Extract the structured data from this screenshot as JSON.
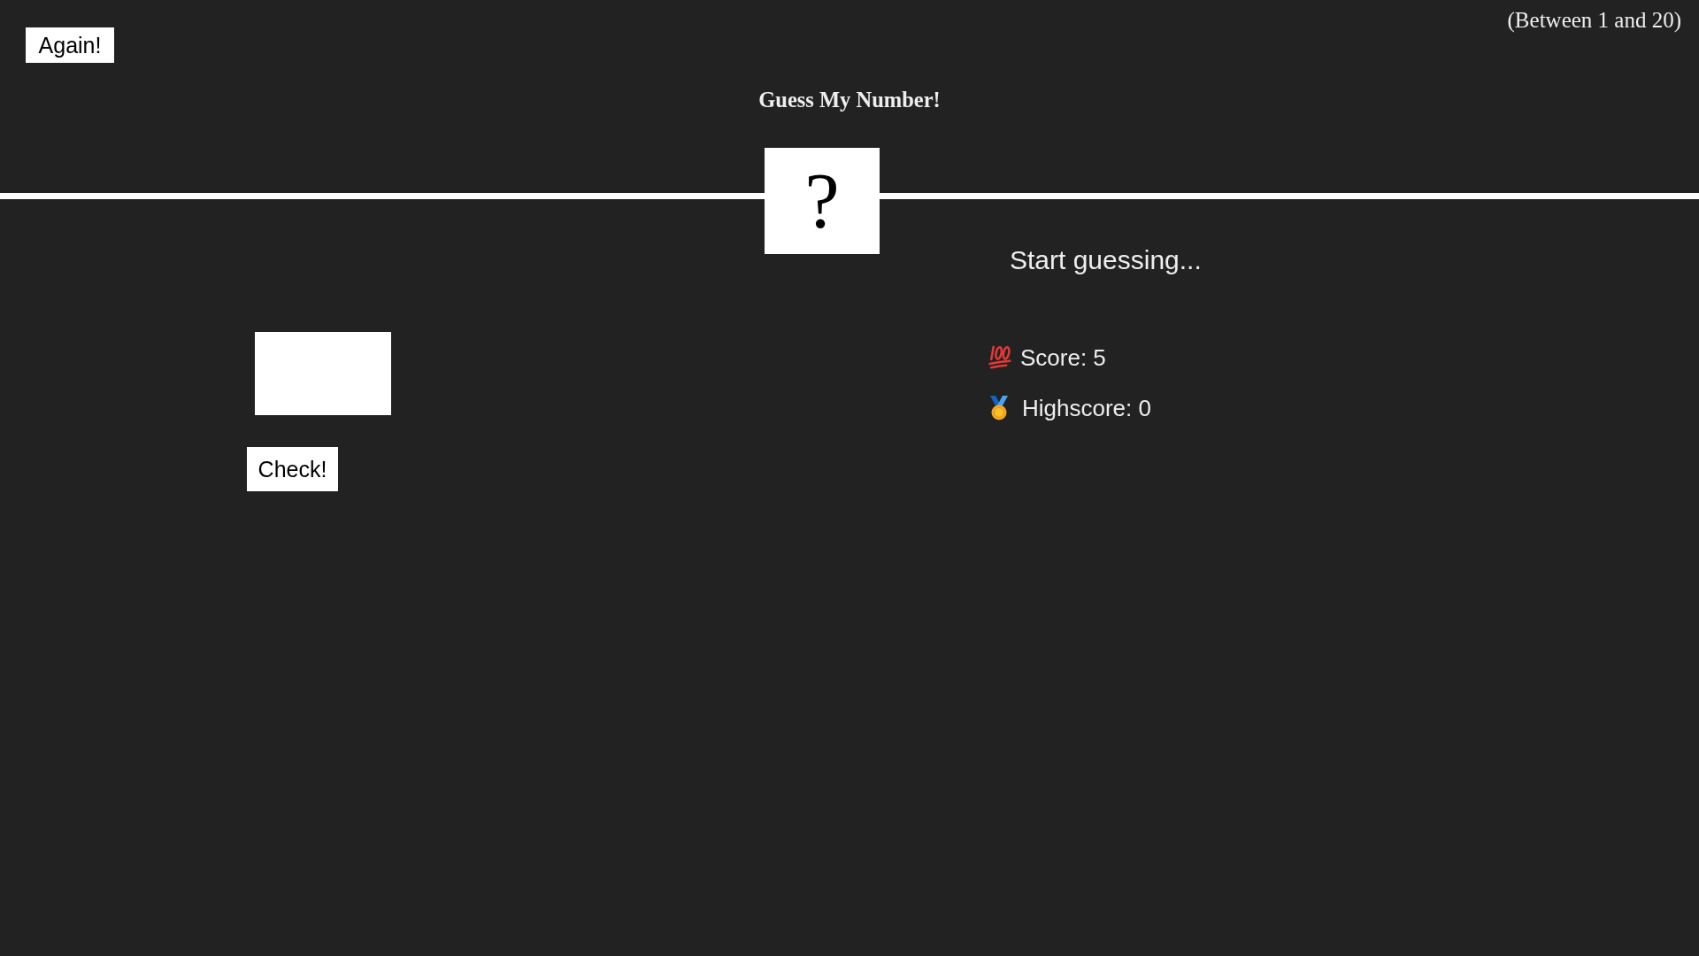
{
  "again_button": "Again!",
  "range_hint": "(Between 1 and 20)",
  "title": "Guess My Number!",
  "secret_number": "?",
  "check_button": "Check!",
  "message": "Start guessing...",
  "stats": [
    {
      "kind": "score",
      "label": "Score: 5"
    },
    {
      "kind": "highscore",
      "label": "Highscore: 0"
    }
  ]
}
